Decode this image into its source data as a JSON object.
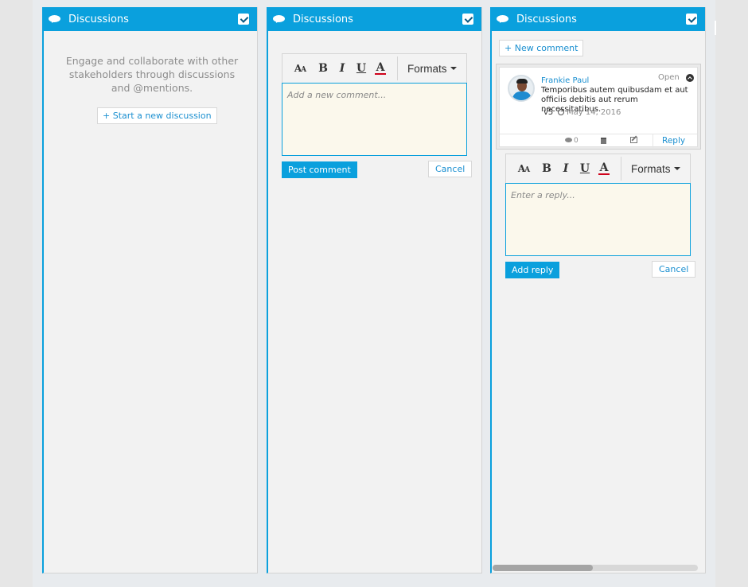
{
  "panels": [
    {
      "title": "Discussions",
      "empty_message": "Engage and collaborate with other stakeholders through discussions and @mentions.",
      "start_button": "+ Start a new discussion"
    },
    {
      "title": "Discussions",
      "toolbar": {
        "formats": "Formats"
      },
      "editor_placeholder": "Add a new comment...",
      "post_button": "Post comment",
      "cancel_button": "Cancel"
    },
    {
      "title": "Discussions",
      "new_comment_button": "+ New comment",
      "comment": {
        "author": "Frankie Paul",
        "status": "Open",
        "text": "Temporibus autem quibusdam et aut officiis debitis aut rerum necessitatibus.",
        "version": "v5",
        "date": "May 14, 2016",
        "reply_count": "0",
        "reply_link": "Reply"
      },
      "toolbar": {
        "formats": "Formats"
      },
      "reply_placeholder": "Enter a reply...",
      "add_reply_button": "Add reply",
      "cancel_button": "Cancel",
      "scroll_position": 0.0
    }
  ],
  "colors": {
    "accent": "#0aa0dd",
    "editor_bg": "#fbf8ec",
    "panel_bg": "#f2f2f2"
  }
}
